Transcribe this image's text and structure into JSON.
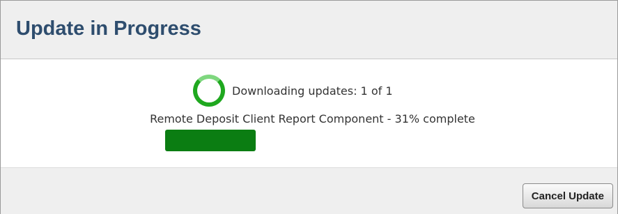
{
  "dialog": {
    "title": "Update in Progress"
  },
  "status": {
    "downloading_text": "Downloading updates: 1 of 1",
    "component_text": "Remote Deposit Client Report Component - 31% complete",
    "progress_percent": 31
  },
  "footer": {
    "cancel_label": "Cancel Update"
  },
  "colors": {
    "title": "#2e4d6e",
    "progress": "#0b7d12",
    "spinner": "#1fa81f"
  },
  "icons": {
    "spinner": "loading-spinner-icon"
  }
}
